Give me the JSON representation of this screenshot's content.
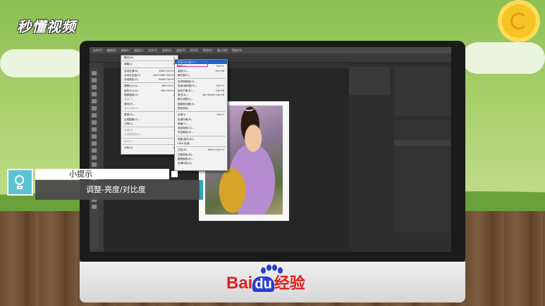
{
  "brand": {
    "name": "秒懂视频"
  },
  "photoshop": {
    "menubar": [
      "文件(F)",
      "编辑(E)",
      "图像(I)",
      "图层(L)",
      "文字(Y)",
      "选择(S)",
      "滤镜(T)",
      "3D(D)",
      "视图(V)",
      "窗口(W)",
      "帮助(H)"
    ],
    "image_menu": [
      {
        "label": "模式(M)",
        "shortcut": ""
      },
      {
        "label": "调整(J)",
        "shortcut": ""
      },
      {
        "label": "自动色调(N)",
        "shortcut": "Shift+Ctrl+L"
      },
      {
        "label": "自动对比度(U)",
        "shortcut": "Alt+Shift+Ctrl+L"
      },
      {
        "label": "自动颜色(O)",
        "shortcut": "Shift+Ctrl+B"
      },
      {
        "label": "图像大小(I)...",
        "shortcut": "Alt+Ctrl+I"
      },
      {
        "label": "画布大小(S)...",
        "shortcut": "Alt+Ctrl+C"
      },
      {
        "label": "图像旋转(G)",
        "shortcut": ""
      },
      {
        "label": "裁剪(P)",
        "shortcut": ""
      },
      {
        "label": "裁切(R)...",
        "shortcut": ""
      },
      {
        "label": "显示全部(V)",
        "shortcut": ""
      },
      {
        "label": "复制(D)...",
        "shortcut": ""
      },
      {
        "label": "应用图像(Y)...",
        "shortcut": ""
      },
      {
        "label": "计算(C)...",
        "shortcut": ""
      },
      {
        "label": "变量(B)",
        "shortcut": ""
      },
      {
        "label": "应用数据组(L)...",
        "shortcut": ""
      },
      {
        "label": "陷印(T)...",
        "shortcut": ""
      },
      {
        "label": "分析(A)",
        "shortcut": ""
      }
    ],
    "adjust_submenu": [
      {
        "label": "亮度/对比度(C)...",
        "shortcut": ""
      },
      {
        "label": "色阶(L)...",
        "shortcut": "Ctrl+L"
      },
      {
        "label": "曲线(U)...",
        "shortcut": "Ctrl+M"
      },
      {
        "label": "曝光度(E)...",
        "shortcut": ""
      },
      {
        "label": "自然饱和度(V)...",
        "shortcut": ""
      },
      {
        "label": "色相/饱和度(H)...",
        "shortcut": "Ctrl+U"
      },
      {
        "label": "色彩平衡(B)...",
        "shortcut": "Ctrl+B"
      },
      {
        "label": "黑白(K)...",
        "shortcut": "Alt+Shift+Ctrl+B"
      },
      {
        "label": "照片滤镜(F)...",
        "shortcut": ""
      },
      {
        "label": "通道混合器(X)...",
        "shortcut": ""
      },
      {
        "label": "颜色查找...",
        "shortcut": ""
      },
      {
        "label": "反相(I)",
        "shortcut": "Ctrl+I"
      },
      {
        "label": "色调分离(P)...",
        "shortcut": ""
      },
      {
        "label": "阈值(T)...",
        "shortcut": ""
      },
      {
        "label": "渐变映射(G)...",
        "shortcut": ""
      },
      {
        "label": "可选颜色(S)...",
        "shortcut": ""
      },
      {
        "label": "阴影/高光(W)...",
        "shortcut": ""
      },
      {
        "label": "HDR 色调...",
        "shortcut": ""
      },
      {
        "label": "去色(D)",
        "shortcut": "Shift+Ctrl+U"
      },
      {
        "label": "匹配颜色(M)...",
        "shortcut": ""
      },
      {
        "label": "替换颜色(R)...",
        "shortcut": ""
      },
      {
        "label": "色调均化(Q)",
        "shortcut": ""
      }
    ]
  },
  "tip": {
    "title": "小提示",
    "text": "调整-亮度/对比度"
  },
  "footer": {
    "bai": "Bai",
    "du": "du",
    "jingyan": "经验"
  },
  "colors": {
    "accent": "#1d63c6",
    "highlight_border": "#e0338f",
    "tip_teal": "#5cc3d3"
  }
}
